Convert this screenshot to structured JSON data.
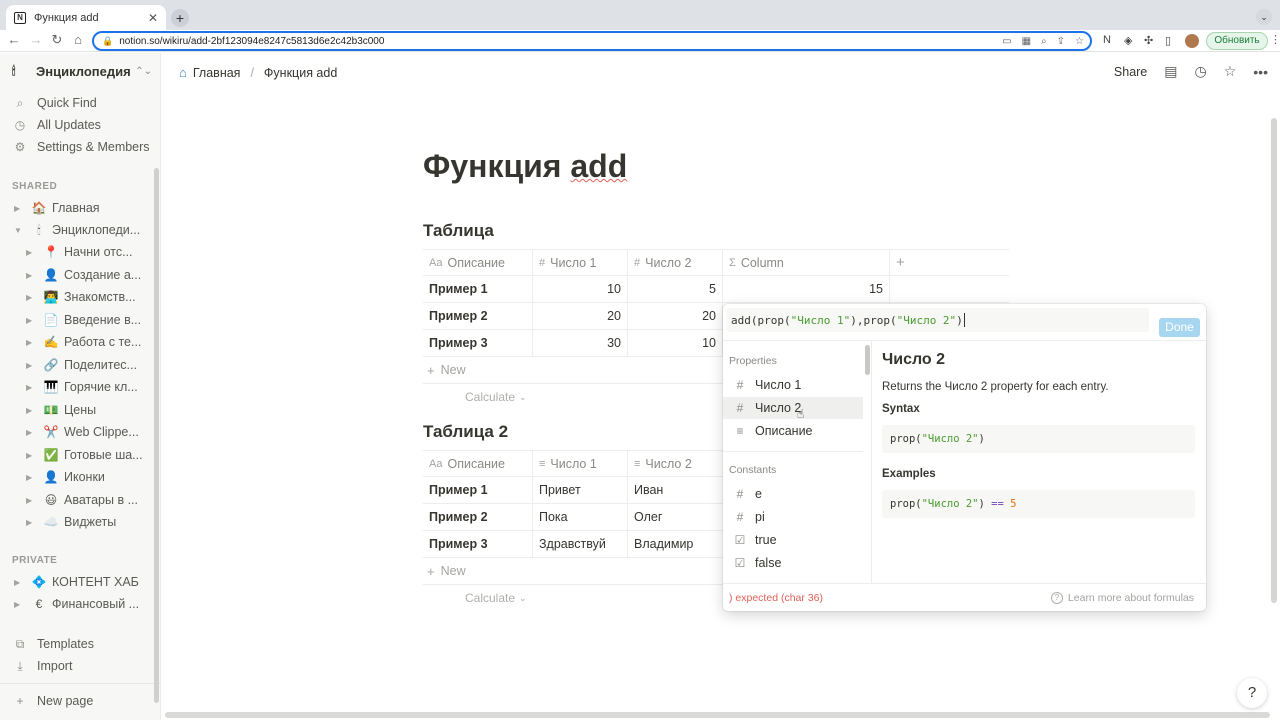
{
  "browser": {
    "tab_title": "Функция add",
    "tab_favicon": "N",
    "url": "notion.so/wikiru/add-2bf123094e8247c5813d6e2c42b3c000",
    "update_label": "Обновить"
  },
  "sidebar": {
    "workspace": "Энциклопедия ...",
    "links": [
      {
        "label": "Quick Find",
        "icon": "search-icon"
      },
      {
        "label": "All Updates",
        "icon": "clock-icon"
      },
      {
        "label": "Settings & Members",
        "icon": "gear-icon"
      }
    ],
    "shared_label": "SHARED",
    "shared": [
      {
        "label": "Главная",
        "emoji": "🏠",
        "level": 0,
        "expanded": false
      },
      {
        "label": "Энциклопеди...",
        "emoji": "🕯",
        "level": 0,
        "expanded": true
      },
      {
        "label": "Начни отс...",
        "emoji": "📍",
        "level": 1
      },
      {
        "label": "Создание а...",
        "emoji": "👤",
        "level": 1
      },
      {
        "label": "Знакомств...",
        "emoji": "👨‍💻",
        "level": 1
      },
      {
        "label": "Введение в...",
        "emoji": "📄",
        "level": 1
      },
      {
        "label": "Работа с те...",
        "emoji": "✍️",
        "level": 1
      },
      {
        "label": "Поделитес...",
        "emoji": "🔗",
        "level": 1
      },
      {
        "label": "Горячие кл...",
        "emoji": "🎹",
        "level": 1
      },
      {
        "label": "Цены",
        "emoji": "💵",
        "level": 1
      },
      {
        "label": "Web Clippe...",
        "emoji": "✂️",
        "level": 1
      },
      {
        "label": "Готовые ша...",
        "emoji": "✅",
        "level": 1
      },
      {
        "label": "Иконки",
        "emoji": "👤",
        "level": 1
      },
      {
        "label": "Аватары в ...",
        "emoji": "😃",
        "level": 1
      },
      {
        "label": "Виджеты",
        "emoji": "☁️",
        "level": 1
      }
    ],
    "private_label": "PRIVATE",
    "private": [
      {
        "label": "КОНТЕНТ ХАБ",
        "emoji": "💠"
      },
      {
        "label": "Финансовый ...",
        "emoji": "€"
      }
    ],
    "bottom_links": [
      {
        "label": "Templates",
        "icon": "templates-icon"
      },
      {
        "label": "Import",
        "icon": "import-icon"
      }
    ],
    "new_page": "New page"
  },
  "topbar": {
    "breadcrumb_home": "Главная",
    "breadcrumb_separator": "/",
    "breadcrumb_page": "Функция add",
    "share": "Share"
  },
  "page": {
    "title_plain": "Функция ",
    "title_marked": "add"
  },
  "table1": {
    "title": "Таблица",
    "headers": [
      {
        "label": "Описание",
        "icon": "Aa"
      },
      {
        "label": "Число 1",
        "icon": "#"
      },
      {
        "label": "Число 2",
        "icon": "#"
      },
      {
        "label": "Column",
        "icon": "Σ"
      }
    ],
    "rows": [
      {
        "name": "Пример 1",
        "n1": "10",
        "n2": "5",
        "col": "15"
      },
      {
        "name": "Пример 2",
        "n1": "20",
        "n2": "20",
        "col": ""
      },
      {
        "name": "Пример 3",
        "n1": "30",
        "n2": "10",
        "col": ""
      }
    ],
    "new_label": "New",
    "calc_label": "Calculate"
  },
  "table2": {
    "title": "Таблица 2",
    "headers": [
      {
        "label": "Описание",
        "icon": "Aa"
      },
      {
        "label": "Число 1",
        "icon": "≡"
      },
      {
        "label": "Число 2",
        "icon": "≡"
      }
    ],
    "rows": [
      {
        "name": "Пример 1",
        "t1": "Привет",
        "t2": "Иван"
      },
      {
        "name": "Пример 2",
        "t1": "Пока",
        "t2": "Олег"
      },
      {
        "name": "Пример 3",
        "t1": "Здравствуй",
        "t2": "Владимир"
      }
    ],
    "new_label": "New",
    "calc_label": "Calculate"
  },
  "formula": {
    "input_parts": [
      "add(prop(",
      "\"Число 1\"",
      "),prop(",
      "\"Число 2\"",
      ")"
    ],
    "done": "Done",
    "properties_label": "Properties",
    "properties": [
      {
        "label": "Число 1",
        "icon": "#"
      },
      {
        "label": "Число 2",
        "icon": "#"
      },
      {
        "label": "Описание",
        "icon": "≡"
      }
    ],
    "constants_label": "Constants",
    "constants": [
      {
        "label": "e",
        "icon": "#"
      },
      {
        "label": "pi",
        "icon": "#"
      },
      {
        "label": "true",
        "icon": "☑"
      },
      {
        "label": "false",
        "icon": "☑"
      }
    ],
    "detail_title": "Число 2",
    "detail_desc": "Returns the Число 2 property for each entry.",
    "syntax_label": "Syntax",
    "syntax_parts": [
      "prop(",
      "\"Число 2\"",
      ")"
    ],
    "examples_label": "Examples",
    "example_parts": [
      "prop(",
      "\"Число 2\"",
      ") ",
      "==",
      " 5"
    ],
    "error": ") expected (char 36)",
    "learn_more": "Learn more about formulas"
  }
}
